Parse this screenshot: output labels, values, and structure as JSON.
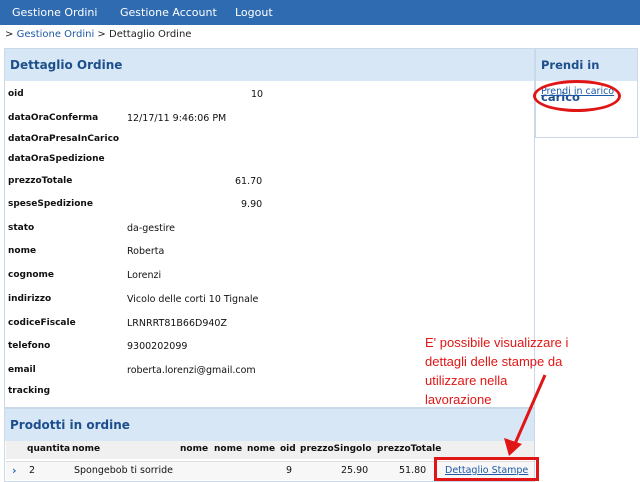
{
  "nav": {
    "items": [
      "Gestione Ordini",
      "Gestione Account",
      "Logout"
    ]
  },
  "breadcrumb": {
    "prefix": ">",
    "link": "Gestione Ordini",
    "separator": ">",
    "current": "Dettaglio Ordine"
  },
  "detail": {
    "title": "Dettaglio Ordine",
    "rows": [
      {
        "label": "oid",
        "value": "10"
      },
      {
        "label": "dataOraConferma",
        "value": "12/17/11 9:46:06 PM"
      },
      {
        "label": "dataOraPresaInCarico",
        "value": ""
      },
      {
        "label": "dataOraSpedizione",
        "value": ""
      },
      {
        "label": "prezzoTotale",
        "value": "61.70"
      },
      {
        "label": "speseSpedizione",
        "value": "9.90"
      },
      {
        "label": "stato",
        "value": "da-gestire"
      },
      {
        "label": "nome",
        "value": "Roberta"
      },
      {
        "label": "cognome",
        "value": "Lorenzi"
      },
      {
        "label": "indirizzo",
        "value": "Vicolo delle corti 10 Tignale"
      },
      {
        "label": "codiceFiscale",
        "value": "LRNRRT81B66D940Z"
      },
      {
        "label": "telefono",
        "value": "9300202099"
      },
      {
        "label": "email",
        "value": "roberta.lorenzi@gmail.com"
      },
      {
        "label": "tracking",
        "value": ""
      }
    ]
  },
  "side": {
    "title": "Prendi in carico",
    "link": "Prendi in carico"
  },
  "products": {
    "title": "Prodotti in ordine",
    "columns": [
      "quantita",
      "nome",
      "nome",
      "nome",
      "nome",
      "oid",
      "prezzoSingolo",
      "prezzoTotale"
    ],
    "row": {
      "quantita": "2",
      "nome": "Spongebob ti sorride",
      "oid": "9",
      "prezzoSingolo": "25.90",
      "prezzoTotale": "51.80",
      "link": "Dettaglio Stampe"
    }
  },
  "annotation": {
    "lines": [
      "E' possibile visualizzare i",
      "dettagli delle stampe da",
      "utilizzare nella",
      "lavorazione"
    ],
    "color": "#e01616"
  },
  "colors": {
    "navbar": "#2e6bb0",
    "panel_header": "#d8e7f5",
    "link": "#1d5aa6"
  }
}
